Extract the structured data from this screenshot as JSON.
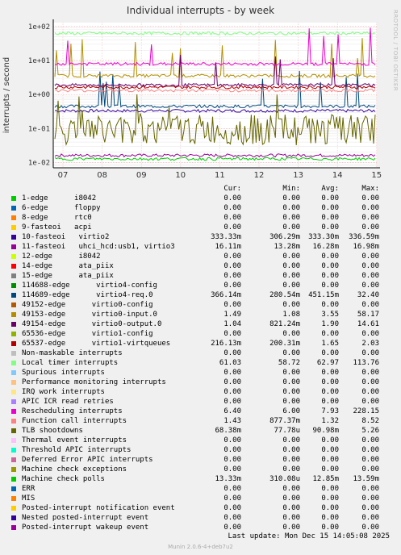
{
  "chart_data": {
    "type": "line",
    "title": "Individual interrupts - by week",
    "ylabel": "interrupts / second",
    "yscale": "log",
    "ylim": [
      0.007,
      20
    ],
    "yticks": [
      {
        "v": 10,
        "label": "1e+01"
      },
      {
        "v": 1,
        "label": "1e+00"
      },
      {
        "v": 0.1,
        "label": "1e-01"
      },
      {
        "v": 0.01,
        "label": "1e-02"
      }
    ],
    "ytop_label": {
      "v": 100,
      "label": "1e+02"
    },
    "x": [
      "07",
      "08",
      "09",
      "10",
      "11",
      "12",
      "13",
      "14",
      "15"
    ],
    "grid": true,
    "legend_columns": [
      "Cur:",
      "Min:",
      "Avg:",
      "Max:"
    ],
    "series": [
      {
        "name": "1-edge      i8042",
        "color": "#00cc00",
        "values": [
          "0.00",
          "0.00",
          "0.00",
          "0.00"
        ]
      },
      {
        "name": "6-edge      floppy",
        "color": "#0066b3",
        "values": [
          "0.00",
          "0.00",
          "0.00",
          "0.00"
        ]
      },
      {
        "name": "8-edge      rtc0",
        "color": "#ff8000",
        "values": [
          "0.00",
          "0.00",
          "0.00",
          "0.00"
        ]
      },
      {
        "name": "9-fasteoi   acpi",
        "color": "#ffcc00",
        "values": [
          "0.00",
          "0.00",
          "0.00",
          "0.00"
        ]
      },
      {
        "name": "10-fasteoi   virtio2",
        "color": "#330099",
        "values": [
          "333.33m",
          "306.29m",
          "333.30m",
          "336.59m"
        ]
      },
      {
        "name": "11-fasteoi   uhci_hcd:usb1, virtio3",
        "color": "#990099",
        "values": [
          "16.11m",
          "13.28m",
          "16.28m",
          "16.98m"
        ]
      },
      {
        "name": "12-edge      i8042",
        "color": "#ccff00",
        "values": [
          "0.00",
          "0.00",
          "0.00",
          "0.00"
        ]
      },
      {
        "name": "14-edge      ata_piix",
        "color": "#ff0000",
        "values": [
          "0.00",
          "0.00",
          "0.00",
          "0.00"
        ]
      },
      {
        "name": "15-edge      ata_piix",
        "color": "#808080",
        "values": [
          "0.00",
          "0.00",
          "0.00",
          "0.00"
        ]
      },
      {
        "name": "114688-edge      virtio4-config",
        "color": "#008f00",
        "values": [
          "0.00",
          "0.00",
          "0.00",
          "0.00"
        ]
      },
      {
        "name": "114689-edge      virtio4-req.0",
        "color": "#00487d",
        "values": [
          "366.14m",
          "280.54m",
          "451.15m",
          "32.40"
        ]
      },
      {
        "name": "49152-edge      virtio0-config",
        "color": "#b35a00",
        "values": [
          "0.00",
          "0.00",
          "0.00",
          "0.00"
        ]
      },
      {
        "name": "49153-edge      virtio0-input.0",
        "color": "#b38f00",
        "values": [
          "1.49",
          "1.08",
          "3.55",
          "58.17"
        ]
      },
      {
        "name": "49154-edge      virtio0-output.0",
        "color": "#6b006b",
        "values": [
          "1.04",
          "821.24m",
          "1.90",
          "14.61"
        ]
      },
      {
        "name": "65536-edge      virtio1-config",
        "color": "#8fb300",
        "values": [
          "0.00",
          "0.00",
          "0.00",
          "0.00"
        ]
      },
      {
        "name": "65537-edge      virtio1-virtqueues",
        "color": "#b30000",
        "values": [
          "216.13m",
          "200.31m",
          "1.65",
          "2.03"
        ]
      },
      {
        "name": "Non-maskable interrupts",
        "color": "#bebebe",
        "values": [
          "0.00",
          "0.00",
          "0.00",
          "0.00"
        ]
      },
      {
        "name": "Local timer interrupts",
        "color": "#80ff80",
        "values": [
          "61.03",
          "58.72",
          "62.97",
          "113.76"
        ]
      },
      {
        "name": "Spurious interrupts",
        "color": "#80c9ff",
        "values": [
          "0.00",
          "0.00",
          "0.00",
          "0.00"
        ]
      },
      {
        "name": "Performance monitoring interrupts",
        "color": "#ffc080",
        "values": [
          "0.00",
          "0.00",
          "0.00",
          "0.00"
        ]
      },
      {
        "name": "IRQ work interrupts",
        "color": "#ffe680",
        "values": [
          "0.00",
          "0.00",
          "0.00",
          "0.00"
        ]
      },
      {
        "name": "APIC ICR read retries",
        "color": "#aa80ff",
        "values": [
          "0.00",
          "0.00",
          "0.00",
          "0.00"
        ]
      },
      {
        "name": "Rescheduling interrupts",
        "color": "#ee00cc",
        "values": [
          "6.40",
          "6.00",
          "7.93",
          "228.15"
        ]
      },
      {
        "name": "Function call interrupts",
        "color": "#ff8080",
        "values": [
          "1.43",
          "877.37m",
          "1.32",
          "8.52"
        ]
      },
      {
        "name": "TLB shootdowns",
        "color": "#666600",
        "values": [
          "68.38m",
          "77.78u",
          "90.98m",
          "5.26"
        ]
      },
      {
        "name": "Thermal event interrupts",
        "color": "#ffbfff",
        "values": [
          "0.00",
          "0.00",
          "0.00",
          "0.00"
        ]
      },
      {
        "name": "Threshold APIC interrupts",
        "color": "#00ffcc",
        "values": [
          "0.00",
          "0.00",
          "0.00",
          "0.00"
        ]
      },
      {
        "name": "Deferred Error APIC interrupts",
        "color": "#cc6699",
        "values": [
          "0.00",
          "0.00",
          "0.00",
          "0.00"
        ]
      },
      {
        "name": "Machine check exceptions",
        "color": "#999900",
        "values": [
          "0.00",
          "0.00",
          "0.00",
          "0.00"
        ]
      },
      {
        "name": "Machine check polls",
        "color": "#00cc00",
        "values": [
          "13.33m",
          "310.08u",
          "12.85m",
          "13.59m"
        ]
      },
      {
        "name": "ERR",
        "color": "#0066b3",
        "values": [
          "0.00",
          "0.00",
          "0.00",
          "0.00"
        ]
      },
      {
        "name": "MIS",
        "color": "#ff8000",
        "values": [
          "0.00",
          "0.00",
          "0.00",
          "0.00"
        ]
      },
      {
        "name": "Posted-interrupt notification event",
        "color": "#ffcc00",
        "values": [
          "0.00",
          "0.00",
          "0.00",
          "0.00"
        ]
      },
      {
        "name": "Nested posted-interrupt event",
        "color": "#330099",
        "values": [
          "0.00",
          "0.00",
          "0.00",
          "0.00"
        ]
      },
      {
        "name": "Posted-interrupt wakeup event",
        "color": "#990099",
        "values": [
          "0.00",
          "0.00",
          "0.00",
          "0.00"
        ]
      }
    ]
  },
  "footer": {
    "last_update": "Last update:  Mon Dec 15 14:05:08 2025",
    "munin": "Munin 2.0.6-4+deb7u2"
  },
  "watermark": "RRDTOOL / TOBI OETIKER"
}
